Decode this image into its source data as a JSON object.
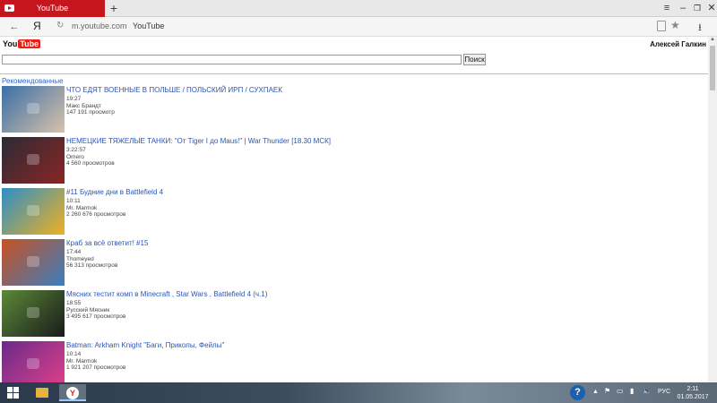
{
  "browser": {
    "tab_title": "YouTube",
    "new_tab_symbol": "+",
    "yandex_symbol": "Я",
    "url_host": "m.youtube.com",
    "page_title": "YouTube"
  },
  "icons": {
    "back": "back-arrow-icon",
    "reload": "reload-icon",
    "bookmark": "star-icon",
    "download": "download-icon"
  },
  "header": {
    "logo_you": "You",
    "logo_tube": "Tube",
    "user_name": "Алексей Галкин"
  },
  "search": {
    "value": "",
    "button_label": "Поиск"
  },
  "section": {
    "title": "Рекомендованные"
  },
  "videos": [
    {
      "title": "ЧТО ЕДЯТ ВОЕННЫЕ В ПОЛЬШЕ / ПОЛЬСКИЙ ИРП / СУХПАЕК",
      "duration": "19:27",
      "channel": "Макс Брандт",
      "views": "147 191 просмотр",
      "colors": [
        "#3a6ea8",
        "#d8c2a8"
      ]
    },
    {
      "title": "НЕМЕЦКИЕ ТЯЖЕЛЫЕ ТАНКИ: \"От Tiger I до Maus!\" | War Thunder [18.30 МСК]",
      "duration": "3:22:57",
      "channel": "Omero",
      "views": "4 560 просмотров",
      "colors": [
        "#2b2b35",
        "#8a2525"
      ]
    },
    {
      "title": "#11 Будние дни в Battlefield 4",
      "duration": "10:11",
      "channel": "Mr. Marmok",
      "views": "2 260 676 просмотров",
      "colors": [
        "#2a8fc8",
        "#f0b020"
      ]
    },
    {
      "title": "Краб за всё ответит! #15",
      "duration": "17:44",
      "channel": "Thomeyed",
      "views": "56 313 просмотров",
      "colors": [
        "#c85020",
        "#3a7fc0"
      ]
    },
    {
      "title": "Мясних тестит комп в Minecraft , Star Wars , Battlefield 4 (ч.1)",
      "duration": "18:55",
      "channel": "Русский Мясник",
      "views": "3 495 617 просмотров",
      "colors": [
        "#5a8a3a",
        "#1a1a1a"
      ]
    },
    {
      "title": "Batman: Arkham Knight \"Баги, Приколы, Фейлы\"",
      "duration": "10:14",
      "channel": "Mr. Marmok",
      "views": "1 921 207 просмотров",
      "colors": [
        "#6a2a8a",
        "#e0408a"
      ]
    }
  ],
  "taskbar": {
    "help_symbol": "?",
    "tray_up": "▲",
    "language": "РУС",
    "time": "2:11",
    "date": "01.05.2017"
  }
}
